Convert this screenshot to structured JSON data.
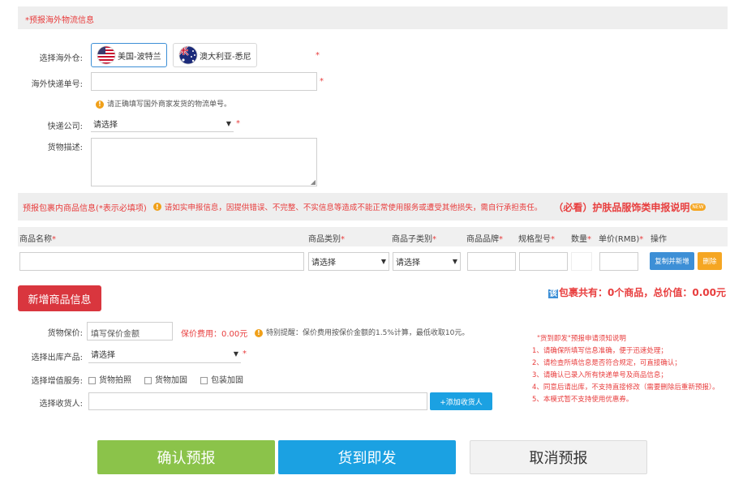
{
  "section1": {
    "title": "*预报海外物流信息",
    "warehouse_label": "选择海外仓:",
    "warehouse_options": [
      {
        "label": "美国-波特兰",
        "flag": "us-flag"
      },
      {
        "label": "澳大利亚-悉尼",
        "flag": "au-flag"
      }
    ],
    "tracking_label": "海外快递单号:",
    "tracking_value": "",
    "tracking_hint": "请正确填写国外商家发货的物流单号。",
    "courier_label": "快递公司:",
    "courier_value": "请选择",
    "description_label": "货物描述:",
    "description_value": "",
    "required_mark": "*"
  },
  "section2": {
    "title": "预报包裹内商品信息(*表示必填项)",
    "warning": "请如实申报信息，因提供错误、不完整、不实信息等造成不能正常使用服务或遭受其他损失，需自行承担责任。",
    "notice_link": "（必看）护肤品服饰类申报说明",
    "new_badge": "NEW",
    "columns": [
      "商品名称",
      "商品类别",
      "商品子类别",
      "商品品牌",
      "规格型号",
      "数量",
      "单价(RMB)",
      "操作"
    ],
    "col_required": [
      true,
      true,
      true,
      true,
      true,
      true,
      true,
      false
    ],
    "row": {
      "name": "",
      "category": "请选择",
      "subcategory": "请选择",
      "brand": "",
      "spec": "",
      "qty": "",
      "price": "",
      "copy_btn": "复制并新增",
      "delete_btn": "删除"
    },
    "add_btn": "新增商品信息",
    "summary_icon": "该",
    "summary": "包裹共有：0个商品，总价值：0.00元"
  },
  "section3": {
    "insured_label": "货物保价:",
    "insured_placeholder": "填写保价金额",
    "insured_fee": "保价费用：0.00元",
    "insured_note": "特别提醒：保价费用按保价金额的1.5%计算，最低收取10元。",
    "product_label": "选择出库产品:",
    "product_value": "请选择",
    "services_label": "选择增值服务:",
    "services": [
      "货物拍照",
      "货物加固",
      "包装加固"
    ],
    "receiver_label": "选择收货人:",
    "receiver_value": "",
    "add_receiver_btn": "+添加收货人",
    "required_mark": "*"
  },
  "notes": {
    "title": "\"货到即发\"预报申请须知说明",
    "items": [
      "1、请确保所填写信息准确，便于迅速处理；",
      "2、请检查所填信息是否符合规定，可直接确认；",
      "3、请确认已录入所有快递单号及商品信息；",
      "4、同意后请出库，不支持直接修改（需要删除后重新预报）。",
      "5、本模式暂不支持使用优惠券。"
    ]
  },
  "actions": {
    "confirm": "确认预报",
    "ship": "货到即发",
    "cancel": "取消预报"
  },
  "colors": {
    "confirm": "#8bc34a",
    "ship": "#1ba1e2",
    "cancel": "#f2f2f2",
    "add": "#d9363e",
    "copy": "#3d8fd6",
    "delete": "#f5a623",
    "accent_red": "#e83d3d"
  }
}
